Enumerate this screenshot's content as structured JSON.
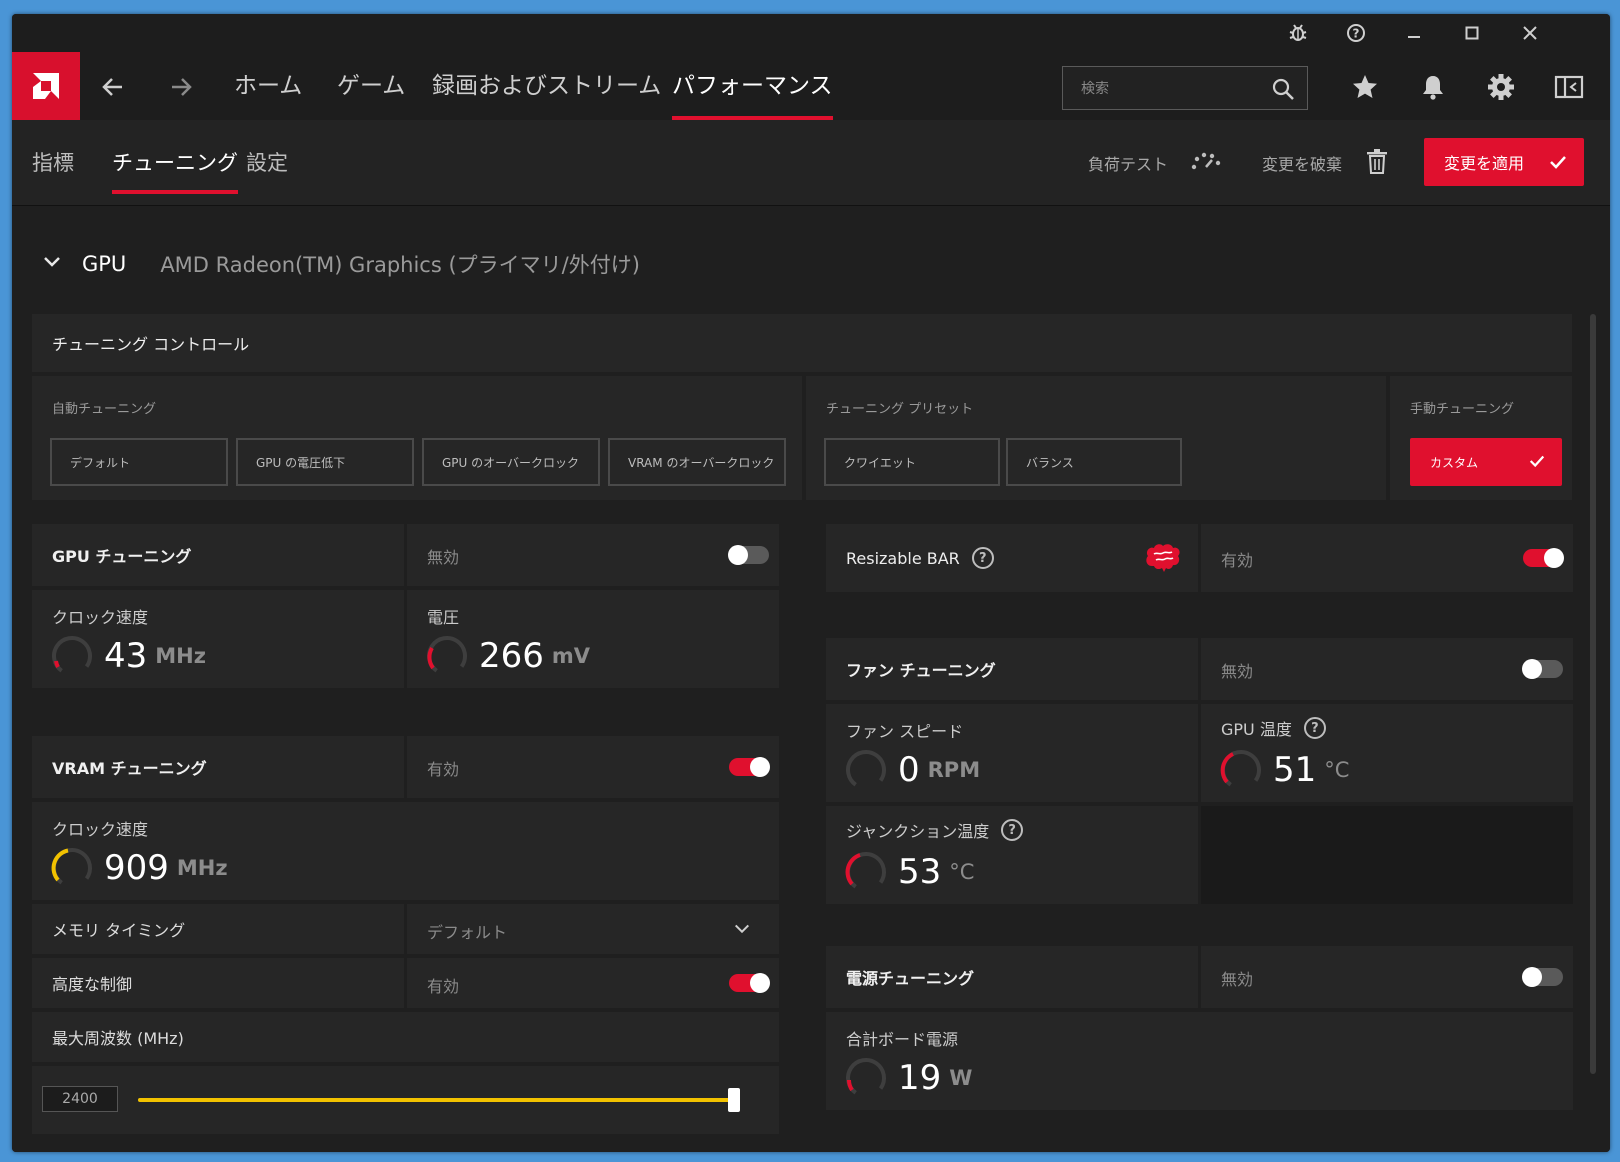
{
  "nav": {
    "tabs": [
      "ホーム",
      "ゲーム",
      "録画およびストリーム",
      "パフォーマンス"
    ],
    "search_placeholder": "検索"
  },
  "subnav": {
    "tabs": [
      "指標",
      "チューニング",
      "設定"
    ],
    "stress_test": "負荷テスト",
    "discard": "変更を破棄",
    "apply": "変更を適用"
  },
  "gpu_header": {
    "label": "GPU",
    "name": "AMD Radeon(TM) Graphics (プライマリ/外付け)"
  },
  "tuning_control": {
    "title": "チューニング コントロール",
    "auto": {
      "label": "自動チューニング",
      "buttons": [
        "デフォルト",
        "GPU の電圧低下",
        "GPU のオーバークロック",
        "VRAM のオーバークロック"
      ]
    },
    "preset": {
      "label": "チューニング プリセット",
      "buttons": [
        "クワイエット",
        "バランス"
      ]
    },
    "manual": {
      "label": "手動チューニング",
      "button": "カスタム"
    }
  },
  "gpu_tuning": {
    "title": "GPU チューニング",
    "state": "無効",
    "enabled": false,
    "clock": {
      "label": "クロック速度",
      "value": "43",
      "unit": "MHz"
    },
    "voltage": {
      "label": "電圧",
      "value": "266",
      "unit": "mV"
    }
  },
  "vram_tuning": {
    "title": "VRAM チューニング",
    "state": "有効",
    "enabled": true,
    "clock": {
      "label": "クロック速度",
      "value": "909",
      "unit": "MHz"
    },
    "memory_timing": {
      "label": "メモリ タイミング",
      "value": "デフォルト"
    },
    "advanced": {
      "label": "高度な制御",
      "state": "有効",
      "enabled": true
    },
    "max_freq": {
      "label": "最大周波数 (MHz)",
      "value": "2400",
      "slider_fraction": 1.0
    }
  },
  "resizable_bar": {
    "title": "Resizable BAR",
    "state": "有効",
    "enabled": true
  },
  "fan_tuning": {
    "title": "ファン チューニング",
    "state": "無効",
    "enabled": false,
    "fan_speed": {
      "label": "ファン スピード",
      "value": "0",
      "unit": "RPM"
    },
    "gpu_temp": {
      "label": "GPU 温度",
      "value": "51",
      "unit": "°C"
    },
    "junction_temp": {
      "label": "ジャンクション温度",
      "value": "53",
      "unit": "°C"
    }
  },
  "power_tuning": {
    "title": "電源チューニング",
    "state": "無効",
    "enabled": false,
    "board_power": {
      "label": "合計ボード電源",
      "value": "19",
      "unit": "W"
    }
  },
  "colors": {
    "accent": "#e0102e",
    "vram": "#f2c200"
  }
}
